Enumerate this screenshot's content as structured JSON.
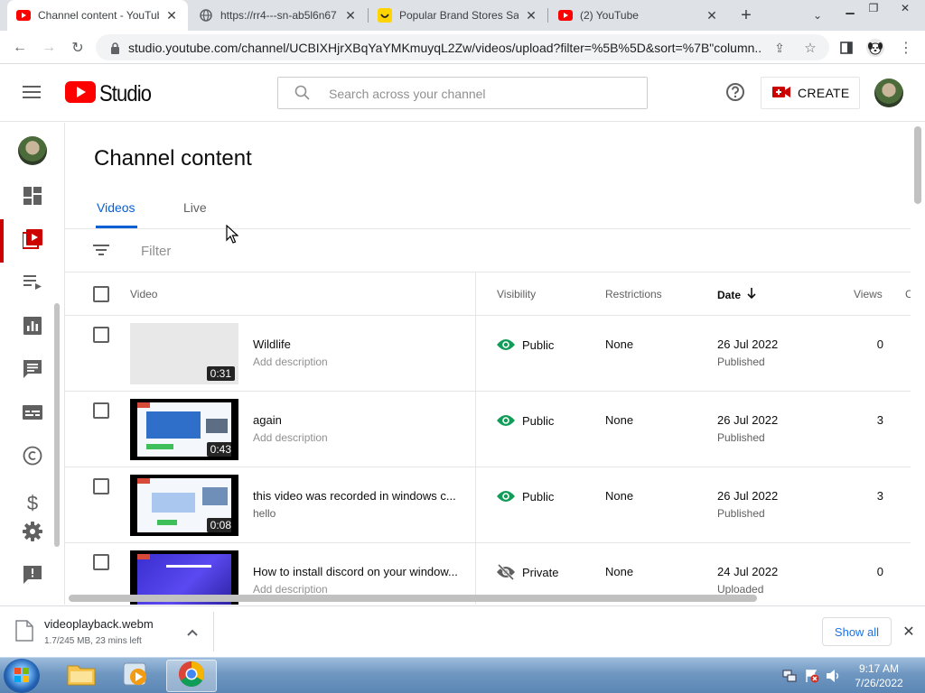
{
  "browser": {
    "tabs": [
      {
        "title": "Channel content - YouTube Studio",
        "favicon": "youtube-icon"
      },
      {
        "title": "https://rr4---sn-ab5l6n67",
        "favicon": "globe-icon"
      },
      {
        "title": "Popular Brand Stores Sale",
        "favicon": "smiley-icon"
      },
      {
        "title": "(2) YouTube",
        "favicon": "youtube-icon"
      }
    ],
    "url": "studio.youtube.com/channel/UCBIXHjrXBqYaYMKmuyqL2Zw/videos/upload?filter=%5B%5D&sort=%7B\"column..."
  },
  "studio": {
    "logo_text": "Studio",
    "search_placeholder": "Search across your channel",
    "create_label": "CREATE"
  },
  "content": {
    "page_title": "Channel content",
    "tabs": [
      {
        "label": "Videos"
      },
      {
        "label": "Live"
      }
    ],
    "filter_placeholder": "Filter",
    "columns": {
      "video": "Video",
      "visibility": "Visibility",
      "restrictions": "Restrictions",
      "date": "Date",
      "views": "Views",
      "comments": "C"
    },
    "rows": [
      {
        "title": "Wildlife",
        "description": "Add description",
        "duration": "0:31",
        "visibility": "Public",
        "visibility_icon": "eye-icon",
        "restrictions": "None",
        "date": "26 Jul 2022",
        "status": "Published",
        "views": "0"
      },
      {
        "title": "again",
        "description": "Add description",
        "duration": "0:43",
        "visibility": "Public",
        "visibility_icon": "eye-icon",
        "restrictions": "None",
        "date": "26 Jul 2022",
        "status": "Published",
        "views": "3"
      },
      {
        "title": "this video was recorded in windows c...",
        "description": "hello",
        "duration": "0:08",
        "visibility": "Public",
        "visibility_icon": "eye-icon",
        "restrictions": "None",
        "date": "26 Jul 2022",
        "status": "Published",
        "views": "3"
      },
      {
        "title": "How to install discord on your window...",
        "description": "Add description",
        "duration": "",
        "visibility": "Private",
        "visibility_icon": "eye-off-icon",
        "restrictions": "None",
        "date": "24 Jul 2022",
        "status": "Uploaded",
        "views": "0"
      }
    ]
  },
  "download": {
    "filename": "videoplayback.webm",
    "progress": "1.7/245 MB, 23 mins left",
    "show_all": "Show all"
  },
  "taskbar": {
    "time": "9:17 AM",
    "date": "7/26/2022"
  },
  "colors": {
    "youtube_red": "#ff0000",
    "active_blue": "#065fd4",
    "public_green": "#0f9d58",
    "nav_active_red": "#cc0000"
  }
}
